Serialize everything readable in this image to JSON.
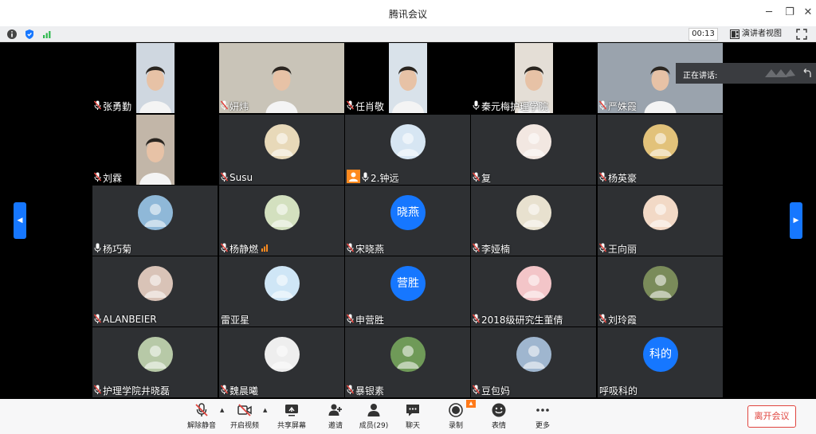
{
  "window": {
    "title": "腾讯会议"
  },
  "status": {
    "timer": "00:13",
    "speaker_view_label": "演讲者视图"
  },
  "speaking": {
    "label": "正在讲话:"
  },
  "participants": [
    {
      "name": "张勇勤",
      "kind": "video",
      "mic": "muted",
      "bg": "#cfd7e0"
    },
    {
      "name": "妍炜",
      "kind": "video-wide",
      "mic": "muted",
      "bg": "#c9c4b8"
    },
    {
      "name": "任肖敬",
      "kind": "video",
      "mic": "muted",
      "bg": "#d9e2ea"
    },
    {
      "name": "秦元梅护理学院",
      "kind": "video",
      "mic": "on",
      "bg": "#e4ded6"
    },
    {
      "name": "严姝霞",
      "kind": "video-wide",
      "mic": "muted",
      "bg": "#9aa3ad"
    },
    {
      "name": "刘霖",
      "kind": "video",
      "mic": "muted",
      "bg": "#c2b6a8"
    },
    {
      "name": "Susu",
      "kind": "avatar",
      "mic": "muted",
      "bg": "#e8d9b9"
    },
    {
      "name": "2.钟远",
      "kind": "avatar",
      "mic": "on",
      "host": true,
      "bg": "#d7e6f3"
    },
    {
      "name": "复",
      "kind": "avatar",
      "mic": "muted",
      "bg": "#f2e7e1"
    },
    {
      "name": "杨英豪",
      "kind": "avatar",
      "mic": "muted",
      "bg": "#e2c27a"
    },
    {
      "name": "杨巧菊",
      "kind": "avatar",
      "mic": "on",
      "bg": "#8fb8d8"
    },
    {
      "name": "杨静燃",
      "kind": "avatar",
      "mic": "muted",
      "signal": true,
      "bg": "#d3e0bf"
    },
    {
      "name": "宋晓燕",
      "kind": "text",
      "mic": "muted",
      "avatar_text": "晓燕"
    },
    {
      "name": "李娅楠",
      "kind": "avatar",
      "mic": "muted",
      "bg": "#e8e1cf"
    },
    {
      "name": "王向丽",
      "kind": "avatar",
      "mic": "muted",
      "bg": "#f2d9c6"
    },
    {
      "name": "ALANBEIER",
      "kind": "avatar",
      "mic": "muted",
      "bg": "#d9c3b7"
    },
    {
      "name": "雷亚星",
      "kind": "avatar",
      "mic": "none",
      "bg": "#cfe6f6"
    },
    {
      "name": "申营胜",
      "kind": "text",
      "mic": "muted",
      "avatar_text": "营胜"
    },
    {
      "name": "2018级研究生董倩",
      "kind": "avatar",
      "mic": "muted",
      "bg": "#f3c5c8"
    },
    {
      "name": "刘玲霞",
      "kind": "avatar",
      "mic": "muted",
      "bg": "#7a8b5a"
    },
    {
      "name": "护理学院井晓磊",
      "kind": "avatar",
      "mic": "muted",
      "bg": "#b7c9a7"
    },
    {
      "name": "魏晨曦",
      "kind": "avatar",
      "mic": "muted",
      "bg": "#eeeeee"
    },
    {
      "name": "暴银素",
      "kind": "avatar",
      "mic": "muted",
      "bg": "#6f9a58"
    },
    {
      "name": "豆包妈",
      "kind": "avatar",
      "mic": "muted",
      "bg": "#9fb6cf"
    },
    {
      "name": "呼吸科的",
      "kind": "text",
      "mic": "none",
      "avatar_text": "科的"
    }
  ],
  "toolbar": {
    "unmute": "解除静音",
    "start_video": "开启视频",
    "share_screen": "共享屏幕",
    "invite": "邀请",
    "members": "成员(29)",
    "chat": "聊天",
    "record": "录制",
    "reactions": "表情",
    "more": "更多",
    "leave": "离开会议"
  },
  "colors": {
    "accent": "#1677ff",
    "danger": "#e0443e",
    "tile_bg": "#2e3033"
  }
}
